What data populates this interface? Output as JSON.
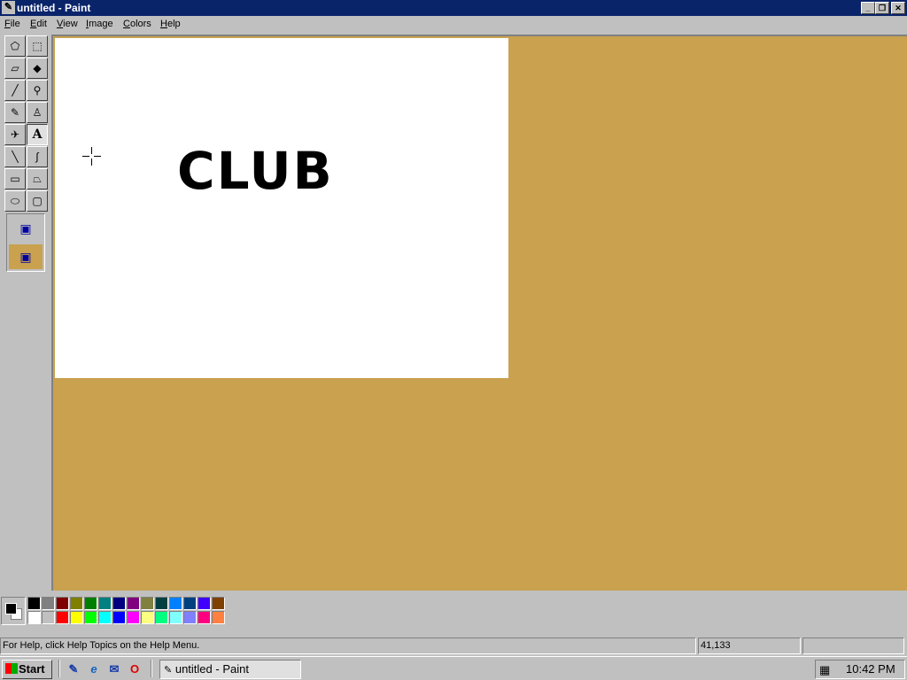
{
  "window": {
    "title": "untitled - Paint",
    "minimize": "_",
    "restore": "❐",
    "close": "✕"
  },
  "menu": [
    {
      "key": "F",
      "rest": "ile"
    },
    {
      "key": "E",
      "rest": "dit"
    },
    {
      "key": "V",
      "rest": "iew"
    },
    {
      "key": "I",
      "rest": "mage"
    },
    {
      "key": "C",
      "rest": "olors"
    },
    {
      "key": "H",
      "rest": "elp"
    }
  ],
  "tools": [
    {
      "name": "free-form-select",
      "glyph": "⬠",
      "icon": "free-form-select-icon"
    },
    {
      "name": "select",
      "glyph": "⬚",
      "icon": "rect-select-icon"
    },
    {
      "name": "eraser",
      "glyph": "▱",
      "icon": "eraser-icon"
    },
    {
      "name": "fill",
      "glyph": "◆",
      "icon": "fill-bucket-icon"
    },
    {
      "name": "pick-color",
      "glyph": "╱",
      "icon": "eyedropper-icon"
    },
    {
      "name": "magnifier",
      "glyph": "⚲",
      "icon": "magnifier-icon"
    },
    {
      "name": "pencil",
      "glyph": "✎",
      "icon": "pencil-icon"
    },
    {
      "name": "brush",
      "glyph": "♙",
      "icon": "brush-icon"
    },
    {
      "name": "airbrush",
      "glyph": "✈",
      "icon": "airbrush-icon"
    },
    {
      "name": "text",
      "glyph": "A",
      "icon": "text-tool-icon"
    },
    {
      "name": "line",
      "glyph": "╲",
      "icon": "line-icon"
    },
    {
      "name": "curve",
      "glyph": "∫",
      "icon": "curve-icon"
    },
    {
      "name": "rectangle",
      "glyph": "▭",
      "icon": "rectangle-icon"
    },
    {
      "name": "polygon",
      "glyph": "⏢",
      "icon": "polygon-icon"
    },
    {
      "name": "ellipse",
      "glyph": "⬭",
      "icon": "ellipse-icon"
    },
    {
      "name": "rounded-rectangle",
      "glyph": "▢",
      "icon": "rounded-rectangle-icon"
    }
  ],
  "active_tool": "text",
  "canvas_text": "CLUB",
  "palette_row1": [
    "#000000",
    "#808080",
    "#800000",
    "#808000",
    "#008000",
    "#008080",
    "#000080",
    "#800080",
    "#808040",
    "#004040",
    "#0080ff",
    "#004080",
    "#4000ff",
    "#804000"
  ],
  "palette_row2": [
    "#ffffff",
    "#c0c0c0",
    "#ff0000",
    "#ffff00",
    "#00ff00",
    "#00ffff",
    "#0000ff",
    "#ff00ff",
    "#ffff80",
    "#00ff80",
    "#80ffff",
    "#8080ff",
    "#ff0080",
    "#ff8040"
  ],
  "colors": {
    "foreground": "#000000",
    "background": "#ffffff",
    "workspace": "#c9a14f",
    "titlebar": "#0a246a"
  },
  "status": {
    "help": "For Help, click Help Topics on the Help Menu.",
    "coords": "41,133",
    "size": ""
  },
  "taskbar": {
    "start": "Start",
    "task": "untitled - Paint",
    "clock": "10:42 PM"
  }
}
